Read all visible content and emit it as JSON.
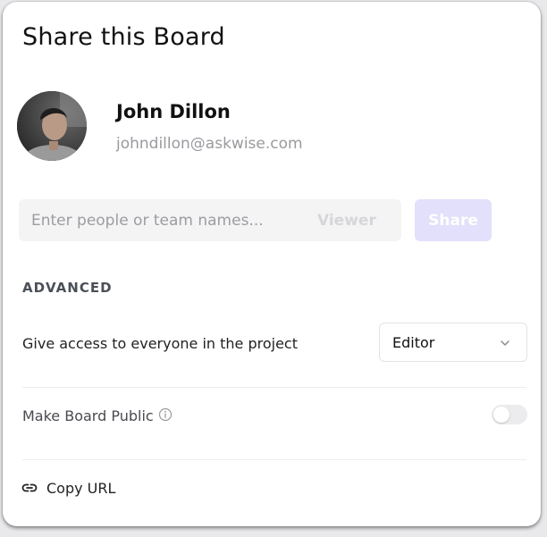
{
  "dialog": {
    "title": "Share this Board"
  },
  "user": {
    "name": "John Dillon",
    "email": "johndillon@askwise.com",
    "avatar_icon": "user-photo"
  },
  "invite": {
    "placeholder": "Enter people or team names...",
    "role_label": "Viewer",
    "share_label": "Share"
  },
  "advanced": {
    "section_title": "ADVANCED",
    "access_label": "Give access to everyone in the project",
    "access_value": "Editor",
    "public_label": "Make Board Public",
    "public_enabled": false,
    "copy_url_label": "Copy URL"
  },
  "colors": {
    "share_disabled": "#e2e0fa",
    "toggle_off": "#ececee"
  }
}
